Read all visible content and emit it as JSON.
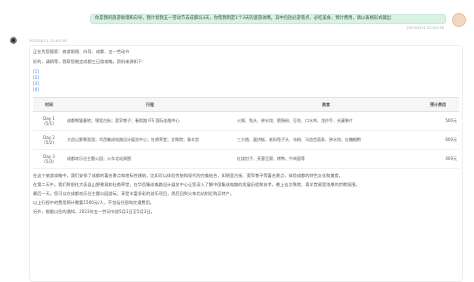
{
  "user_message": {
    "text": "你是我的旅游助理和向导。我计划我五一劳动节去成都玩3天，你帮我制定1个3天的旅游攻略，其中包括必游景点、必吃美食、预计费用，请以表格形式输出",
    "timestamp": "2023/4/11 21:04:30"
  },
  "assistant_message": {
    "timestamp": "2023/4/11 21:05:18",
    "intro": "正在为您搜索：旅游助理、向导、成都、五一劳动节",
    "greeting": "好的，请稍等，我帮您制定成都三日游攻略，资料来源如下：",
    "refs": [
      "[1]",
      "[2]",
      "[3]",
      "[4]"
    ],
    "table": {
      "headers": [
        "时间",
        "行程",
        "美食",
        "预计费用"
      ],
      "rows": [
        {
          "day": "Day 1",
          "date": "(5/1)",
          "itinerary": "成都熊猫基地；锦里古街；宽窄巷子；春熙路 IFS 国际金融中心",
          "food": "火锅、兔头、钟水饺、肥肠粉、豆花、口水鸡、龙抄手、夫妻肺片",
          "cost": "500元"
        },
        {
          "day": "Day 2",
          "date": "(5/2)",
          "itinerary": "大邑山野景观游；华西集成电路设计展览中心；杜甫草堂；文殊院；青羊宫",
          "food": "三大炮、蛋烘糕、老妈兔子头、冰粉、马齿苋面条、钟水饺、红糖糍粑",
          "cost": "600元"
        },
        {
          "day": "Day 3",
          "date": "(5/3)",
          "itinerary": "成都欢乐谷主题公园；火车北站周围",
          "food": "红烧肘子、芙蓉豆腐、烤鸭、牛肉面等",
          "cost": "400元"
        }
      ]
    },
    "paragraphs": [
      "在这个旅游攻略中，我们安排了成都的著名景点和地标性建筑，比如可以体验传统和现代的完美结合，如锦里古街、宽窄巷子等著名景点，体验成都的特色文化和美食。",
      "在第二天中，我们将前往大邑县山野景观和杜甫草堂，在华西集成电路设计展览中心让您深入了解中国集成电路的发展历程和技术，晚上去文殊院、青羊宫感受浓厚的宗教氛围。",
      "最后一天，您可以在成都欢乐谷主题公园游玩，享受丰富多彩的游乐项目，然后回到火车北站附近购买特产。",
      "以上行程中的费用预计需要1500元/人，不包括住宿和交通费用。",
      "另外，根据以往的通知，2023年五一劳动节放5月1日至5月3日。"
    ]
  }
}
